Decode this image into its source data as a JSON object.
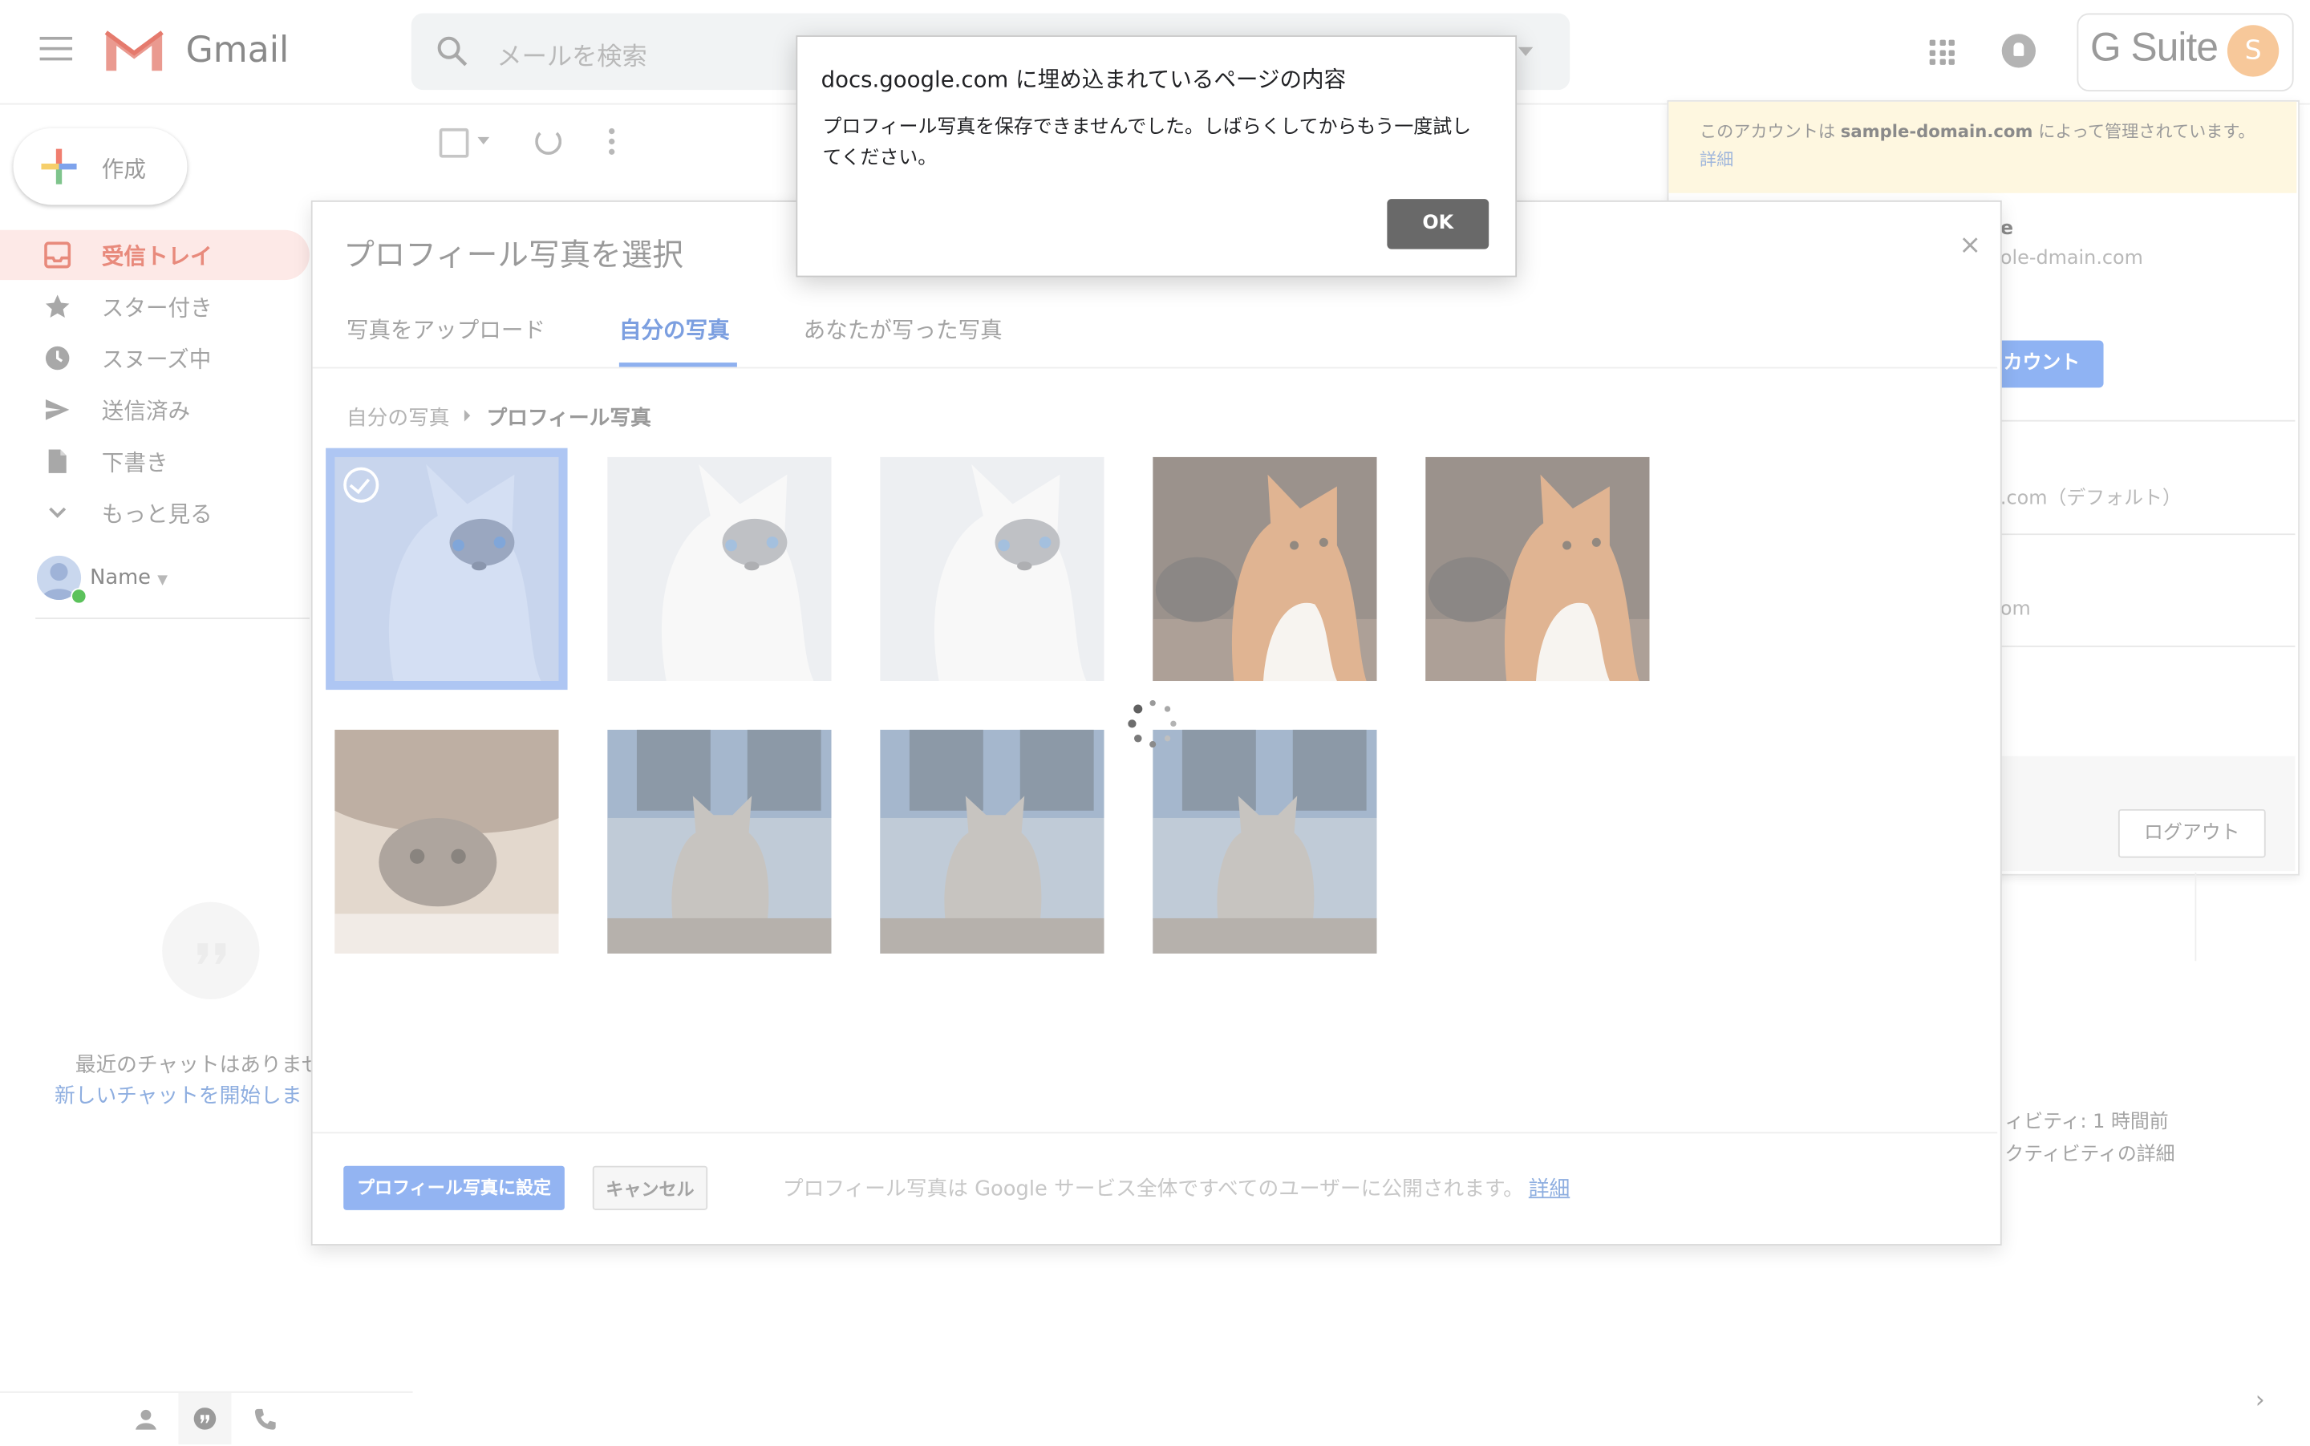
{
  "header": {
    "app_name": "Gmail",
    "search_placeholder": "メールを検索",
    "suite_label": "G Suite",
    "avatar_initial": "S"
  },
  "sidebar": {
    "compose_label": "作成",
    "items": [
      {
        "label": "受信トレイ",
        "icon": "inbox-icon",
        "active": true
      },
      {
        "label": "スター付き",
        "icon": "star-icon"
      },
      {
        "label": "スヌーズ中",
        "icon": "clock-icon"
      },
      {
        "label": "送信済み",
        "icon": "send-icon"
      },
      {
        "label": "下書き",
        "icon": "draft-icon"
      },
      {
        "label": "もっと見る",
        "icon": "chevron-down-icon"
      }
    ],
    "user_name": "Name",
    "chat_empty": "最近のチャットはありませ",
    "chat_start": "新しいチャットを開始しま"
  },
  "account_panel": {
    "banner_prefix": "このアカウントは ",
    "banner_domain": "sample-domain.com",
    "banner_suffix": " によって管理されています。",
    "banner_link": "詳細",
    "name_fragment": "e",
    "email_fragment": "ole-dmain.com",
    "account_button": "カウント",
    "default_fragment": ".com（デフォルト）",
    "om_fragment": "om",
    "logout_label": "ログアウト",
    "activity_line1": "ィビティ: 1 時間前",
    "activity_line2": "クティビティの詳細"
  },
  "picker": {
    "title": "プロフィール写真を選択",
    "tabs": [
      {
        "label": "写真をアップロード"
      },
      {
        "label": "自分の写真",
        "active": true
      },
      {
        "label": "あなたが写った写真"
      }
    ],
    "breadcrumb": [
      "自分の写真",
      "プロフィール写真"
    ],
    "close_label": "×",
    "set_button": "プロフィール写真に設定",
    "cancel_button": "キャンセル",
    "footer_note": "プロフィール写真は Google サービス全体ですべてのユーザーに公開されます。",
    "footer_link": "詳細",
    "photos": [
      {
        "kind": "white-cat",
        "selected": true
      },
      {
        "kind": "white-cat"
      },
      {
        "kind": "white-cat"
      },
      {
        "kind": "ginger-cat"
      },
      {
        "kind": "ginger-cat"
      },
      {
        "kind": "tabby-cat"
      },
      {
        "kind": "grey-cat"
      },
      {
        "kind": "grey-cat"
      },
      {
        "kind": "grey-cat"
      }
    ]
  },
  "alert": {
    "title": "docs.google.com に埋め込まれているページの内容",
    "message": "プロフィール写真を保存できませんでした。しばらくしてからもう一度試してください。",
    "ok_label": "OK"
  },
  "colors": {
    "accent_blue": "#8eb0ef",
    "inbox_red": "#e88a7c",
    "banner_yellow": "#fef7e0",
    "ok_button": "#696969"
  }
}
